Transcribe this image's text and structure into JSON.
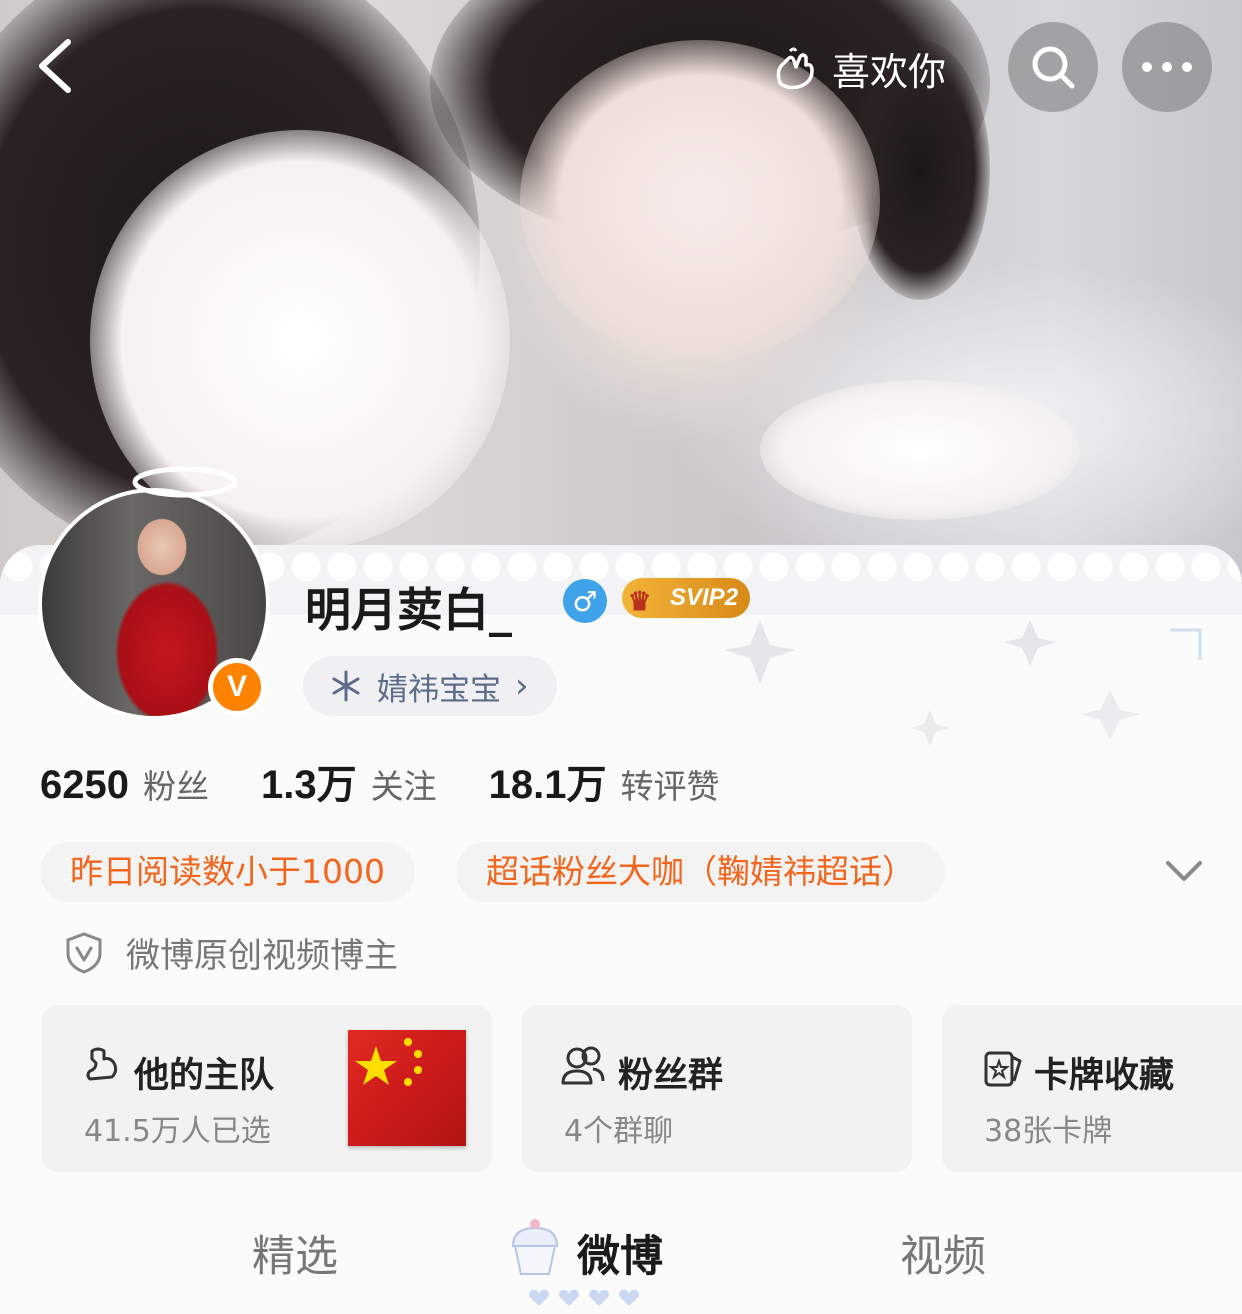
{
  "topbar": {
    "back_icon": "chevron-left-icon",
    "like_label": "喜欢你",
    "like_icon": "hand-heart-icon",
    "search_icon": "search-icon",
    "more_icon": "more-dots-icon"
  },
  "profile": {
    "username": "明月荬白_",
    "gender_symbol": "♂",
    "svip_label": "SVIP2",
    "verified_mark": "V",
    "group_label": "婧祎宝宝",
    "group_icon": "snowflake-icon",
    "group_chevron": "›",
    "stats": [
      {
        "value": "6250",
        "label": "粉丝"
      },
      {
        "value": "1.3万",
        "label": "关注"
      },
      {
        "value": "18.1万",
        "label": "转评赞"
      }
    ],
    "tags": [
      "昨日阅读数小于1000",
      "超话粉丝大咖（鞠婧祎超话）"
    ],
    "certification": "微博原创视频博主"
  },
  "boxes": [
    {
      "title": "他的主队",
      "sub": "41.5万人已选",
      "icon": "team-icon"
    },
    {
      "title": "粉丝群",
      "sub": "4个群聊",
      "icon": "group-icon"
    },
    {
      "title": "卡牌收藏",
      "sub": "38张卡牌",
      "icon": "card-icon"
    }
  ],
  "tabs": [
    {
      "label": "精选",
      "active": false
    },
    {
      "label": "微博",
      "active": true
    },
    {
      "label": "视频",
      "active": false
    }
  ],
  "colors": {
    "accent_orange": "#f2661d",
    "verified_orange": "#ff8200",
    "gender_blue": "#3fa3ea",
    "group_text": "#5b6c8c"
  }
}
